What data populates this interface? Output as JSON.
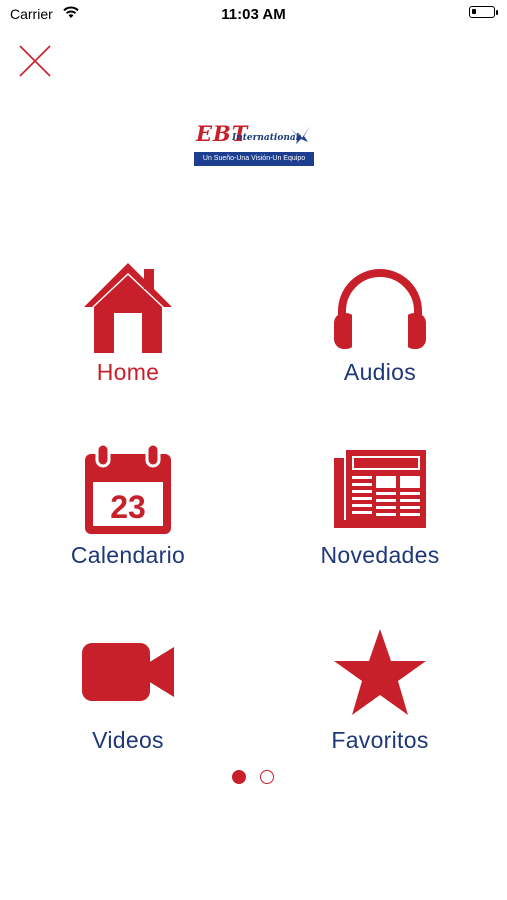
{
  "status_bar": {
    "carrier": "Carrier",
    "time": "11:03 AM",
    "battery_level": 0.2
  },
  "header": {
    "close_icon": "close-icon"
  },
  "logo": {
    "title": "EBT",
    "subtitle": "International",
    "tagline": "Un Sueño-Una Visión-Un Equipo"
  },
  "menu": {
    "items": [
      {
        "label": "Home",
        "icon": "home-icon",
        "active": true
      },
      {
        "label": "Audios",
        "icon": "headphones-icon",
        "active": false
      },
      {
        "label": "Calendario",
        "icon": "calendar-icon",
        "active": false,
        "icon_text": "23"
      },
      {
        "label": "Novedades",
        "icon": "newspaper-icon",
        "active": false
      },
      {
        "label": "Videos",
        "icon": "video-camera-icon",
        "active": false
      },
      {
        "label": "Favoritos",
        "icon": "star-icon",
        "active": false
      }
    ]
  },
  "pagination": {
    "pages": 2,
    "current": 1
  },
  "colors": {
    "accent_red": "#c8202a",
    "navy": "#1d3779"
  }
}
